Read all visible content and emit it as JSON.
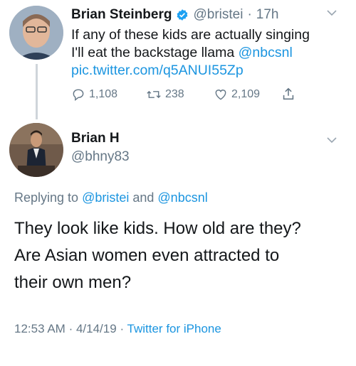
{
  "tweet1": {
    "name": "Brian Steinberg",
    "handle": "@bristei",
    "sep": "·",
    "time": "17h",
    "text_line1": "If any of these kids are actually singing",
    "text_line2_plain": "I'll eat the backstage llama ",
    "mention": "@nbcsnl",
    "link": "pic.twitter.com/q5ANUI55Zp",
    "replies": "1,108",
    "retweets": "238",
    "likes": "2,109"
  },
  "tweet2": {
    "name": "Brian H",
    "handle": "@bhny83",
    "replying_prefix": "Replying to ",
    "replying_mention1": "@bristei",
    "replying_and": " and ",
    "replying_mention2": "@nbcsnl",
    "text_line1": "They look like kids. How old are they?",
    "text_line2": "Are Asian women even attracted to",
    "text_line3": "their own men?",
    "time": "12:53 AM",
    "sep1": "·",
    "date": "4/14/19",
    "sep2": "·",
    "source": "Twitter for iPhone"
  },
  "colors": {
    "link": "#1b95e0",
    "muted": "#657786",
    "verified": "#1da1f2"
  },
  "icons": [
    "verified-badge-icon",
    "chevron-down-icon",
    "reply-icon",
    "retweet-icon",
    "like-icon",
    "share-icon"
  ]
}
